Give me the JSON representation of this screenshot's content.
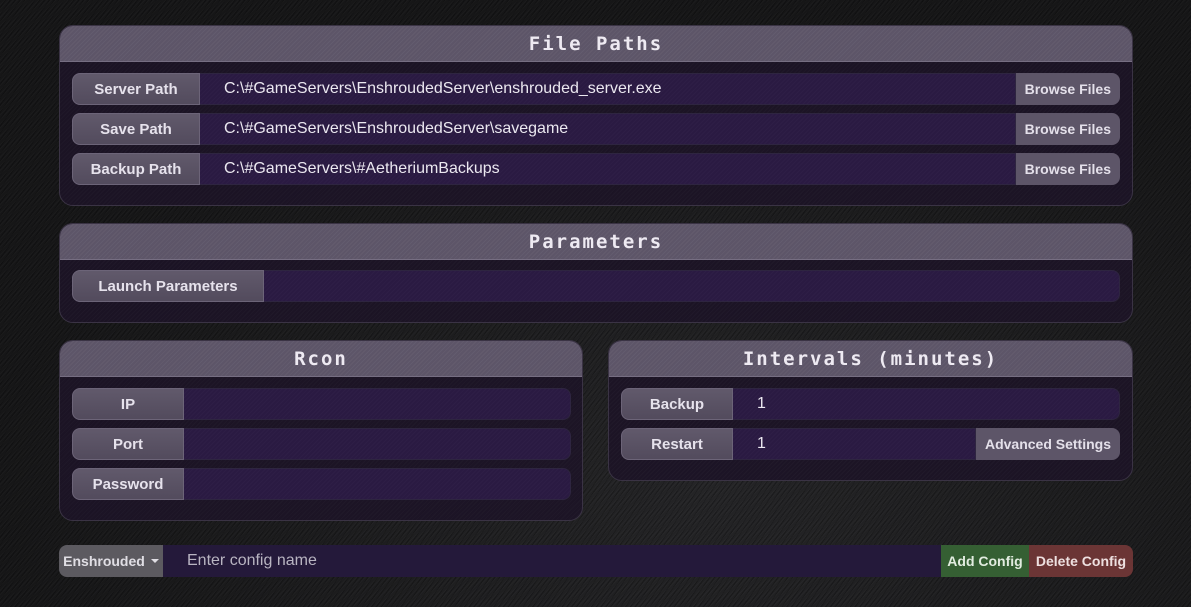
{
  "file_paths": {
    "title": "File Paths",
    "rows": [
      {
        "label": "Server Path",
        "value": "C:\\#GameServers\\EnshroudedServer\\enshrouded_server.exe",
        "button": "Browse Files"
      },
      {
        "label": "Save Path",
        "value": "C:\\#GameServers\\EnshroudedServer\\savegame",
        "button": "Browse Files"
      },
      {
        "label": "Backup Path",
        "value": "C:\\#GameServers\\#AetheriumBackups",
        "button": "Browse Files"
      }
    ]
  },
  "parameters": {
    "title": "Parameters",
    "rows": [
      {
        "label": "Launch Parameters",
        "value": ""
      }
    ]
  },
  "rcon": {
    "title": "Rcon",
    "rows": [
      {
        "label": "IP",
        "value": ""
      },
      {
        "label": "Port",
        "value": ""
      },
      {
        "label": "Password",
        "value": ""
      }
    ]
  },
  "intervals": {
    "title": "Intervals (minutes)",
    "rows": [
      {
        "label": "Backup",
        "value": "1"
      },
      {
        "label": "Restart",
        "value": "1",
        "button": "Advanced Settings"
      }
    ]
  },
  "bottom_bar": {
    "game_select": "Enshrouded",
    "config_name_value": "",
    "config_name_placeholder": "Enter config name",
    "add_label": "Add Config",
    "delete_label": "Delete Config"
  },
  "colors": {
    "panel_header": "#5d5568",
    "input_bg": "#2a1a42",
    "add_button": "#355f33",
    "delete_button": "#6b3535"
  }
}
